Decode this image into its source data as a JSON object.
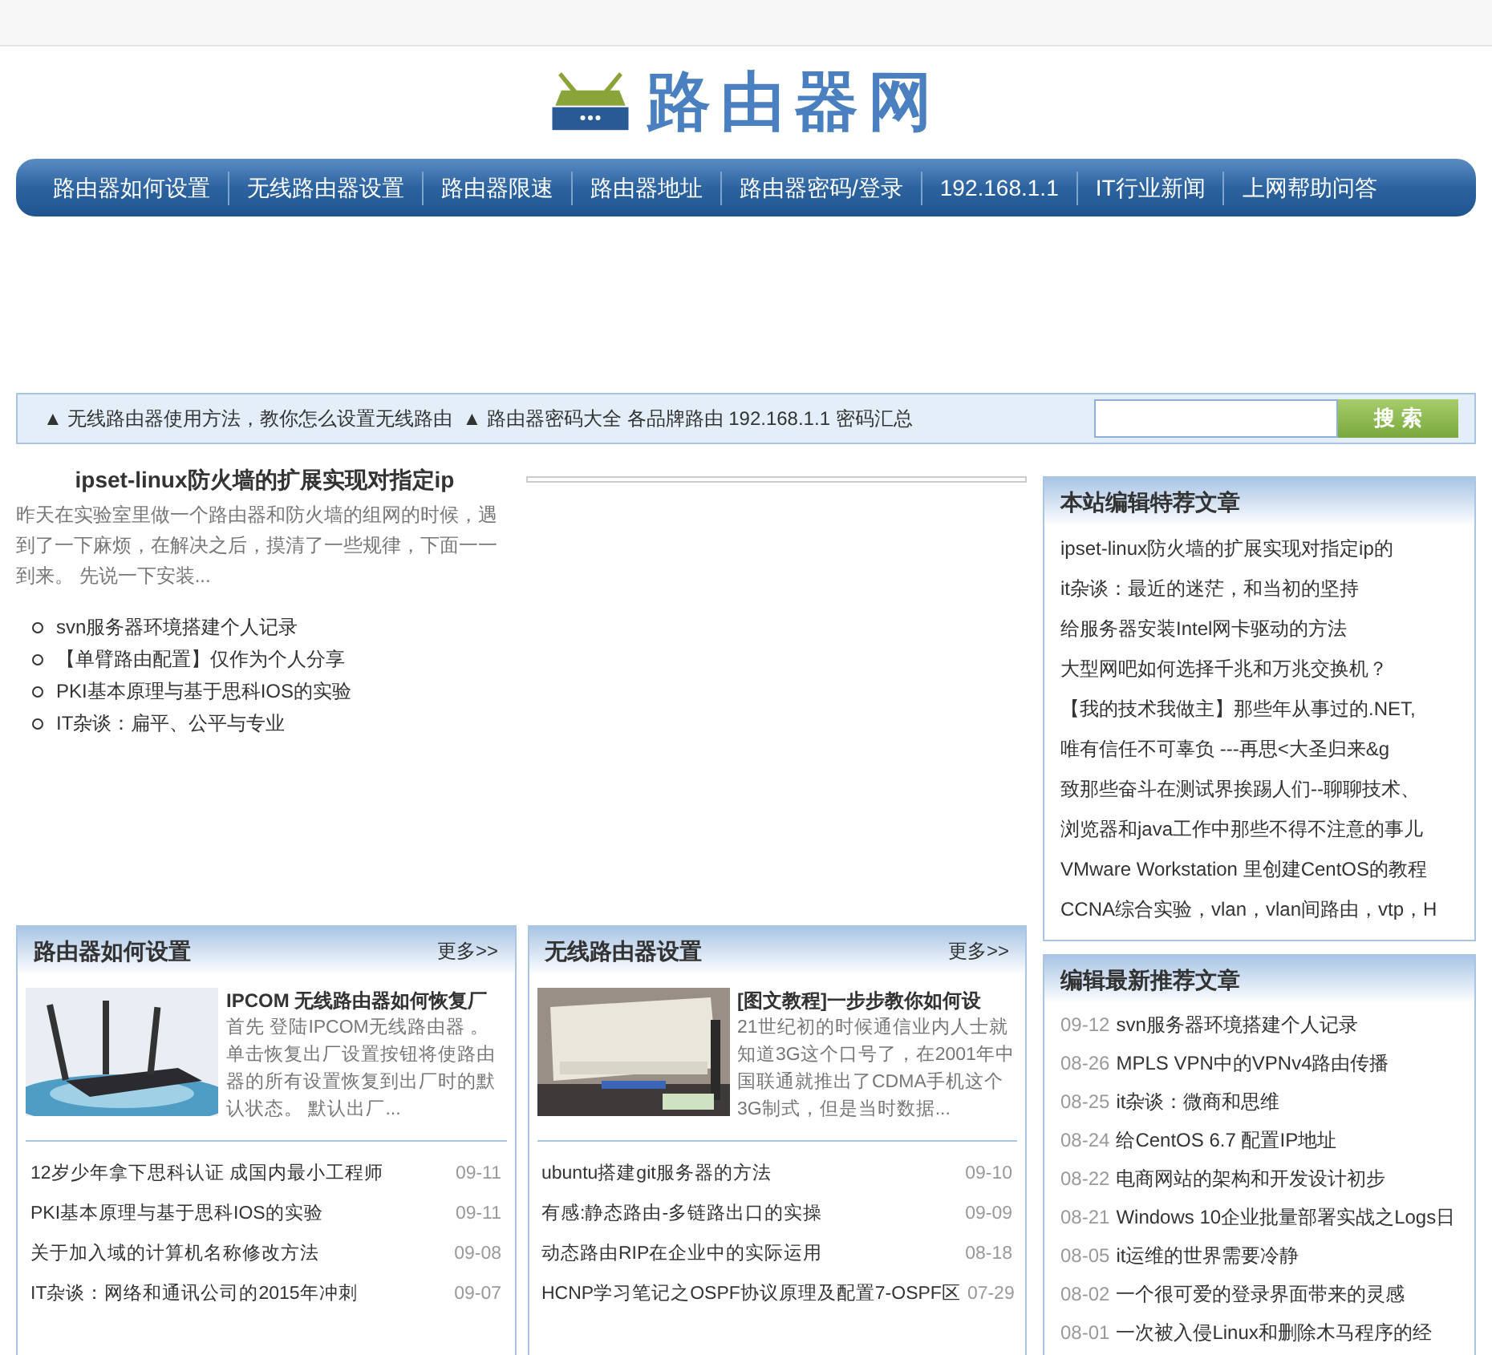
{
  "logo": {
    "text": "路由器网"
  },
  "nav": [
    "路由器如何设置",
    "无线路由器设置",
    "路由器限速",
    "路由器地址",
    "路由器密码/登录",
    "192.168.1.1",
    "IT行业新闻",
    "上网帮助问答"
  ],
  "ticker": [
    "▲ 无线路由器使用方法，教你怎么设置无线路由",
    "▲ 路由器密码大全 各品牌路由 192.168.1.1 密码汇总"
  ],
  "search": {
    "button": "搜 索"
  },
  "featured": {
    "title": "ipset-linux防火墙的扩展实现对指定ip",
    "summary": "昨天在实验室里做一个路由器和防火墙的组网的时候，遇到了一下麻烦，在解决之后，摸清了一些规律，下面一一到来。 先说一下安装...",
    "list": [
      "svn服务器环境搭建个人记录",
      "【单臂路由配置】仅作为个人分享",
      "PKI基本原理与基于思科IOS的实验",
      "IT杂谈：扁平、公平与专业"
    ]
  },
  "editor_picks": {
    "title": "本站编辑特荐文章",
    "items": [
      "ipset-linux防火墙的扩展实现对指定ip的",
      "it杂谈：最近的迷茫，和当初的坚持",
      "给服务器安装Intel网卡驱动的方法",
      "大型网吧如何选择千兆和万兆交换机？",
      "【我的技术我做主】那些年从事过的.NET,",
      "唯有信任不可辜负 ---再思<大圣归来&g",
      "致那些奋斗在测试界挨踢人们--聊聊技术、",
      "浏览器和java工作中那些不得不注意的事儿",
      "VMware Workstation 里创建CentOS的教程",
      "CCNA综合实验，vlan，vlan间路由，vtp，H"
    ]
  },
  "sections": [
    {
      "title": "路由器如何设置",
      "more": "更多>>",
      "lead": {
        "kind": "picture",
        "title": "IPCOM 无线路由器如何恢复厂",
        "summary": "首先 登陆IPCOM无线路由器 。单击恢复出厂设置按钮将使路由器的所有设置恢复到出厂时的默认状态。 默认出厂..."
      },
      "items": [
        {
          "title": "12岁少年拿下思科认证 成国内最小工程师",
          "date": "09-11"
        },
        {
          "title": "PKI基本原理与基于思科IOS的实验",
          "date": "09-11"
        },
        {
          "title": "关于加入域的计算机名称修改方法",
          "date": "09-08"
        },
        {
          "title": "IT杂谈：网络和通讯公司的2015年冲刺",
          "date": "09-07"
        }
      ]
    },
    {
      "title": "无线路由器设置",
      "more": "更多>>",
      "lead": {
        "kind": "picture",
        "title": "[图文教程]一步步教你如何设",
        "summary": "21世纪初的时候通信业内人士就知道3G这个口号了，在2001年中国联通就推出了CDMA手机这个3G制式，但是当时数据..."
      },
      "items": [
        {
          "title": "ubuntu搭建git服务器的方法",
          "date": "09-10"
        },
        {
          "title": "有感:静态路由-多链路出口的实操",
          "date": "09-09"
        },
        {
          "title": "动态路由RIP在企业中的实际运用",
          "date": "08-18"
        },
        {
          "title": "HCNP学习笔记之OSPF协议原理及配置7-OSPF区",
          "date": "07-29"
        }
      ]
    }
  ],
  "latest": {
    "title": "编辑最新推荐文章",
    "items": [
      {
        "date": "09-12",
        "title": "svn服务器环境搭建个人记录"
      },
      {
        "date": "08-26",
        "title": "MPLS VPN中的VPNv4路由传播"
      },
      {
        "date": "08-25",
        "title": "it杂谈：微商和思维"
      },
      {
        "date": "08-24",
        "title": "给CentOS 6.7 配置IP地址"
      },
      {
        "date": "08-22",
        "title": "电商网站的架构和开发设计初步"
      },
      {
        "date": "08-21",
        "title": "Windows 10企业批量部署实战之Logs日"
      },
      {
        "date": "08-05",
        "title": "it运维的世界需要冷静"
      },
      {
        "date": "08-02",
        "title": "一个很可爱的登录界面带来的灵感"
      },
      {
        "date": "08-01",
        "title": "一次被入侵Linux和删除木马程序的经"
      }
    ]
  }
}
